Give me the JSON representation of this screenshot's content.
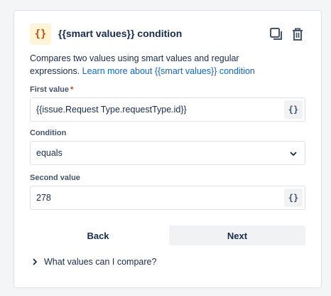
{
  "component": {
    "badge_icon": "{}",
    "title": "{{smart values}} condition",
    "copy_icon": "copy-icon",
    "delete_icon": "trash-icon",
    "description": "Compares two values using smart values and regular expressions.",
    "learn_more_link": "Learn more about {{smart values}} condition"
  },
  "form": {
    "first_value": {
      "label": "First value",
      "required_marker": "*",
      "value": "{{issue.Request Type.requestType.id}}",
      "smart_value_button": "{}"
    },
    "condition": {
      "label": "Condition",
      "selected": "equals"
    },
    "second_value": {
      "label": "Second value",
      "value": "278",
      "smart_value_button": "{}"
    }
  },
  "actions": {
    "back_label": "Back",
    "next_label": "Next"
  },
  "help": {
    "expander_label": "What values can I compare?"
  },
  "colors": {
    "link": "#0c66e4",
    "badge_bg": "#fff4d6",
    "badge_fg": "#c25100",
    "required": "#c9372c"
  }
}
